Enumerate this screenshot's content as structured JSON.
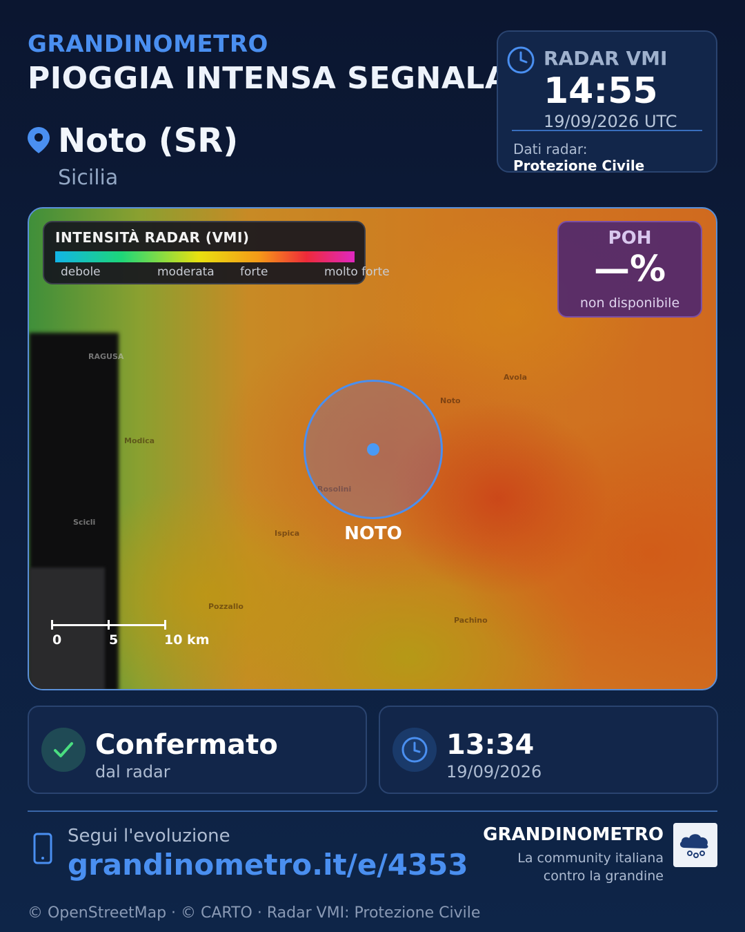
{
  "header": {
    "brand": "GRANDINOMETRO",
    "headline": "PIOGGIA INTENSA SEGNALATA"
  },
  "location": {
    "city": "Noto (SR)",
    "region": "Sicilia",
    "icon": "map-pin-icon"
  },
  "radar_card": {
    "label": "RADAR VMI",
    "time": "14:55",
    "date": "19/09/2026 UTC",
    "source_label": "Dati radar:",
    "source_value": "Protezione Civile",
    "icon": "clock-icon"
  },
  "map": {
    "legend": {
      "title": "INTENSITÀ RADAR (VMI)",
      "ticks": [
        "debole",
        "moderata",
        "forte",
        "molto forte"
      ]
    },
    "poh": {
      "label": "POH",
      "value": "—%",
      "sub": "non disponibile"
    },
    "marker_label": "NOTO",
    "places": [
      "RAGUSA",
      "Modica",
      "Scicli",
      "Avola",
      "Noto",
      "Rosolini",
      "Ispica",
      "Pozzallo",
      "Pachino"
    ],
    "scale": {
      "zero": "0",
      "mid": "5",
      "end": "10 km"
    }
  },
  "stats": {
    "confirmed": {
      "title": "Confermato",
      "sub": "dal radar",
      "icon": "checkmark-icon"
    },
    "report_time": {
      "title": "13:34",
      "sub": "19/09/2026",
      "icon": "clock-icon"
    }
  },
  "footer": {
    "follow": "Segui l'evoluzione",
    "link": "grandinometro.it/e/4353",
    "brand": "GRANDINOMETRO",
    "tagline_1": "La community italiana",
    "tagline_2": "contro la grandine",
    "credits": "© OpenStreetMap · © CARTO · Radar VMI: Protezione Civile"
  },
  "colors": {
    "accent": "#4a8ff0",
    "background": "#0b1630",
    "card": "#12264a",
    "poh_bg": "#50286e",
    "confirm_green": "#4ade80"
  }
}
